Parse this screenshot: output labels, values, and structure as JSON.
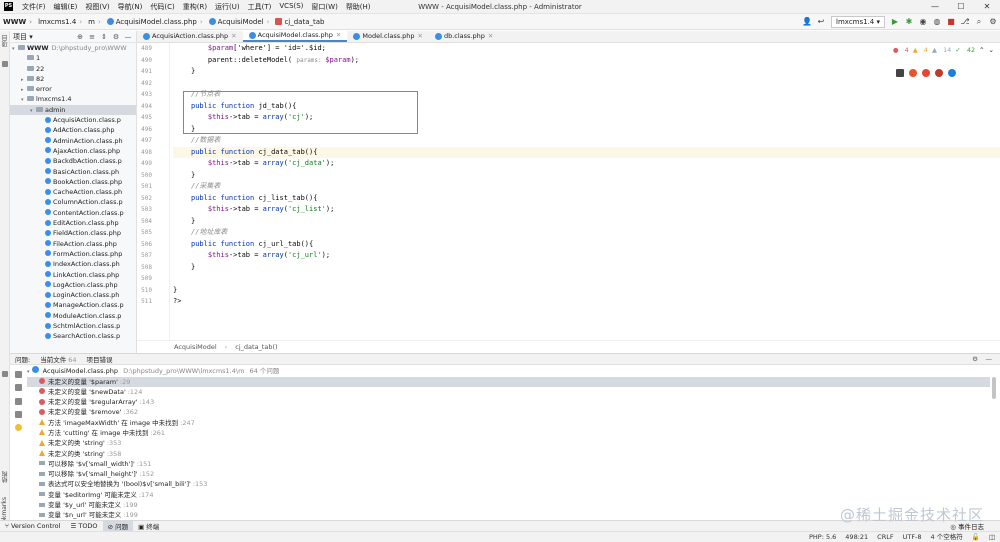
{
  "menubar": {
    "items": [
      "文件(F)",
      "编辑(E)",
      "视图(V)",
      "导航(N)",
      "代码(C)",
      "重构(R)",
      "运行(U)",
      "工具(T)",
      "VCS(S)",
      "窗口(W)",
      "帮助(H)"
    ],
    "title": "WWW - AcquisiModel.class.php - Administrator",
    "controls": [
      "—",
      "☐",
      "✕"
    ]
  },
  "navbar": {
    "breadcrumbs": [
      "WWW",
      "lmxcms1.4",
      "m",
      "AcquisiModel.class.php",
      "AcquisiModel",
      "cj_data_tab"
    ],
    "run_config": "lmxcms1.4 ▾"
  },
  "project": {
    "label": "项目 ▾",
    "tree": [
      {
        "label": "WWW",
        "path": "D:\\phpstudy_pro\\WWW",
        "depth": 0,
        "type": "folder",
        "expanded": true,
        "bold": true
      },
      {
        "label": "1",
        "depth": 1,
        "type": "folder"
      },
      {
        "label": "22",
        "depth": 1,
        "type": "folder"
      },
      {
        "label": "82",
        "depth": 1,
        "type": "folder",
        "collapsed": true
      },
      {
        "label": "error",
        "depth": 1,
        "type": "folder",
        "collapsed": true
      },
      {
        "label": "lmxcms1.4",
        "depth": 1,
        "type": "folder",
        "expanded": true
      },
      {
        "label": "admin",
        "depth": 2,
        "type": "folder",
        "expanded": true,
        "selected": true
      },
      {
        "label": "AcquisiAction.class.p",
        "depth": 3,
        "type": "class"
      },
      {
        "label": "AdAction.class.php",
        "depth": 3,
        "type": "class"
      },
      {
        "label": "AdminAction.class.ph",
        "depth": 3,
        "type": "class"
      },
      {
        "label": "AjaxAction.class.php",
        "depth": 3,
        "type": "class"
      },
      {
        "label": "BackdbAction.class.p",
        "depth": 3,
        "type": "class"
      },
      {
        "label": "BasicAction.class.ph",
        "depth": 3,
        "type": "class"
      },
      {
        "label": "BookAction.class.php",
        "depth": 3,
        "type": "class"
      },
      {
        "label": "CacheAction.class.ph",
        "depth": 3,
        "type": "class"
      },
      {
        "label": "ColumnAction.class.p",
        "depth": 3,
        "type": "class"
      },
      {
        "label": "ContentAction.class.p",
        "depth": 3,
        "type": "class"
      },
      {
        "label": "EditAction.class.php",
        "depth": 3,
        "type": "class"
      },
      {
        "label": "FieldAction.class.php",
        "depth": 3,
        "type": "class"
      },
      {
        "label": "FileAction.class.php",
        "depth": 3,
        "type": "class"
      },
      {
        "label": "FormAction.class.php",
        "depth": 3,
        "type": "class"
      },
      {
        "label": "IndexAction.class.ph",
        "depth": 3,
        "type": "class"
      },
      {
        "label": "LinkAction.class.php",
        "depth": 3,
        "type": "class"
      },
      {
        "label": "LogAction.class.php",
        "depth": 3,
        "type": "class"
      },
      {
        "label": "LoginAction.class.ph",
        "depth": 3,
        "type": "class"
      },
      {
        "label": "ManageAction.class.p",
        "depth": 3,
        "type": "class"
      },
      {
        "label": "ModuleAction.class.p",
        "depth": 3,
        "type": "class"
      },
      {
        "label": "SchtmlAction.class.p",
        "depth": 3,
        "type": "class"
      },
      {
        "label": "SearchAction.class.p",
        "depth": 3,
        "type": "class"
      }
    ]
  },
  "tabs": [
    {
      "label": "AcquisiAction.class.php",
      "active": false
    },
    {
      "label": "AcquisiModel.class.php",
      "active": true
    },
    {
      "label": "Model.class.php",
      "active": false
    },
    {
      "label": "db.class.php",
      "active": false
    }
  ],
  "inspections": {
    "errors": "4",
    "warnings": "4",
    "weak": "14",
    "typos": "42"
  },
  "code_lines": [
    {
      "n": "489",
      "t": [
        [
          "    "
        ],
        [
          "$param",
          "vr"
        ],
        [
          "['where'] = 'id='.$id;"
        ]
      ]
    },
    {
      "n": "490",
      "t": [
        [
          "    parent::deleteModel( "
        ],
        [
          "params: ",
          "hint"
        ],
        [
          "$param",
          "vr"
        ],
        [
          ");"
        ]
      ]
    },
    {
      "n": "491",
      "t": [
        [
          "}"
        ]
      ]
    },
    {
      "n": "492",
      "t": [
        [
          ""
        ]
      ]
    },
    {
      "n": "493",
      "t": [
        [
          "//节点表",
          "cm"
        ]
      ]
    },
    {
      "n": "494",
      "t": [
        [
          "public function ",
          "kw"
        ],
        [
          "jd_tab(){"
        ]
      ]
    },
    {
      "n": "495",
      "t": [
        [
          "    "
        ],
        [
          "$this",
          "vr"
        ],
        [
          "->tab = "
        ],
        [
          "array",
          "kw"
        ],
        [
          "("
        ],
        [
          "'cj'",
          "st"
        ],
        [
          ");"
        ]
      ]
    },
    {
      "n": "496",
      "t": [
        [
          "}"
        ]
      ]
    },
    {
      "n": "497",
      "t": [
        [
          "//数据表",
          "cm"
        ]
      ]
    },
    {
      "n": "498",
      "hl": true,
      "t": [
        [
          "public function ",
          "kw"
        ],
        [
          "cj_data_tab(){"
        ]
      ]
    },
    {
      "n": "499",
      "t": [
        [
          "    "
        ],
        [
          "$this",
          "vr"
        ],
        [
          "->tab = "
        ],
        [
          "array",
          "kw"
        ],
        [
          "("
        ],
        [
          "'cj_data'",
          "st"
        ],
        [
          ");"
        ]
      ]
    },
    {
      "n": "500",
      "t": [
        [
          "}"
        ]
      ]
    },
    {
      "n": "501",
      "t": [
        [
          "//采集表",
          "cm"
        ]
      ]
    },
    {
      "n": "502",
      "t": [
        [
          "public function ",
          "kw"
        ],
        [
          "cj_list_tab(){"
        ]
      ]
    },
    {
      "n": "503",
      "t": [
        [
          "    "
        ],
        [
          "$this",
          "vr"
        ],
        [
          "->tab = "
        ],
        [
          "array",
          "kw"
        ],
        [
          "("
        ],
        [
          "'cj_list'",
          "st"
        ],
        [
          ");"
        ]
      ]
    },
    {
      "n": "504",
      "t": [
        [
          "}"
        ]
      ]
    },
    {
      "n": "505",
      "t": [
        [
          "//地址库表",
          "cm"
        ]
      ]
    },
    {
      "n": "506",
      "t": [
        [
          "public function ",
          "kw"
        ],
        [
          "cj_url_tab(){"
        ]
      ]
    },
    {
      "n": "507",
      "t": [
        [
          "    "
        ],
        [
          "$this",
          "vr"
        ],
        [
          "->tab = "
        ],
        [
          "array",
          "kw"
        ],
        [
          "("
        ],
        [
          "'cj_url'",
          "st"
        ],
        [
          ");"
        ]
      ]
    },
    {
      "n": "508",
      "t": [
        [
          "}"
        ]
      ]
    },
    {
      "n": "509",
      "t": [
        [
          ""
        ]
      ]
    },
    {
      "n": "510",
      "t": [
        [
          "}",
          "root"
        ]
      ]
    },
    {
      "n": "511",
      "t": [
        [
          "?>",
          "root"
        ]
      ]
    }
  ],
  "editor_breadcrumb": [
    "AcquisiModel",
    "cj_data_tab()"
  ],
  "problems": {
    "tabs": [
      {
        "label": "问题:"
      },
      {
        "label": "当前文件",
        "count": "64"
      },
      {
        "label": "项目错误"
      }
    ],
    "file": {
      "name": "AcquisiModel.class.php",
      "path": "D:\\phpstudy_pro\\WWW\\lmxcms1.4\\m",
      "count": "64 个问题"
    },
    "items": [
      {
        "sev": "error",
        "text": "未定义的变量 '$param'",
        "line": ":29",
        "selected": true
      },
      {
        "sev": "error",
        "text": "未定义的变量 '$newData'",
        "line": ":124"
      },
      {
        "sev": "error",
        "text": "未定义的变量 '$regularArray'",
        "line": ":143"
      },
      {
        "sev": "error",
        "text": "未定义的变量 '$remove'",
        "line": ":362"
      },
      {
        "sev": "warning",
        "text": "方法 'imageMaxWidth' 在 image 中未找到",
        "line": ":247"
      },
      {
        "sev": "warning",
        "text": "方法 'cutting' 在 image 中未找到",
        "line": ":261"
      },
      {
        "sev": "warning",
        "text": "未定义的类 'string'",
        "line": ":353"
      },
      {
        "sev": "warning",
        "text": "未定义的类 'string'",
        "line": ":358"
      },
      {
        "sev": "weak",
        "text": "可以移除 '$v['small_width']'",
        "line": ":151"
      },
      {
        "sev": "weak",
        "text": "可以移除 '$v['small_height']'",
        "line": ":152"
      },
      {
        "sev": "weak",
        "text": "表达式可以安全地替换为 '(bool)$v['small_bili']'",
        "line": ":153"
      },
      {
        "sev": "weak",
        "text": "变量 '$editorImg' 可能未定义",
        "line": ":174"
      },
      {
        "sev": "weak",
        "text": "变量 '$y_url' 可能未定义",
        "line": ":199"
      },
      {
        "sev": "weak",
        "text": "变量 '$n_url' 可能未定义",
        "line": ":199"
      }
    ]
  },
  "bottom_tabs": [
    {
      "label": "Version Control"
    },
    {
      "label": "TODO"
    },
    {
      "label": "问题",
      "active": true
    },
    {
      "label": "终端"
    }
  ],
  "event_log": "事件日志",
  "status": {
    "php": "PHP: 5.6",
    "pos": "498:21",
    "eol": "CRLF",
    "enc": "UTF-8",
    "indent": "4 个空格符"
  },
  "watermark": "@稀土掘金技术社区",
  "left_tool": {
    "project": "项目",
    "structure": "结构",
    "bookmarks": "Bookmarks"
  },
  "colors": {
    "error": "#db5c5c",
    "warning": "#f0a732",
    "accent": "#4a86c7",
    "selection": "#d5dae0",
    "highlight_box": "#e0606a"
  }
}
